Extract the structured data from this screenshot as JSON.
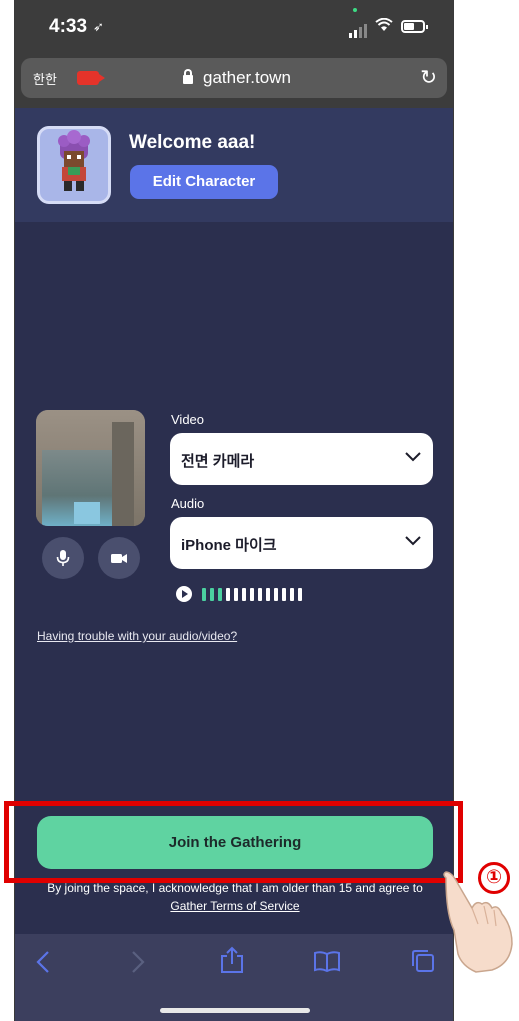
{
  "status_bar": {
    "time": "4:33",
    "location_glyph": "➶"
  },
  "browser": {
    "aa_label": "한한",
    "domain": "gather.town",
    "reload_glyph": "↻"
  },
  "header": {
    "welcome": "Welcome aaa!",
    "edit_character_label": "Edit Character"
  },
  "media": {
    "video_label": "Video",
    "video_value": "전면 카메라",
    "audio_label": "Audio",
    "audio_value": "iPhone 마이크",
    "audio_level_active_bars": 3,
    "audio_level_total_bars": 13,
    "trouble_link": "Having trouble with your audio/video?"
  },
  "join": {
    "button_label": "Join the Gathering",
    "legal_text": "By joing the space, I acknowledge that I am older than 15 and agree to",
    "terms_link": "Gather Terms of Service"
  },
  "annotation": {
    "step_number": "①",
    "highlight_color": "#e00000"
  },
  "colors": {
    "page_bg": "#2b2f4e",
    "header_bg": "#333a60",
    "accent_blue": "#5b74e8",
    "join_green": "#5fd3a1"
  }
}
